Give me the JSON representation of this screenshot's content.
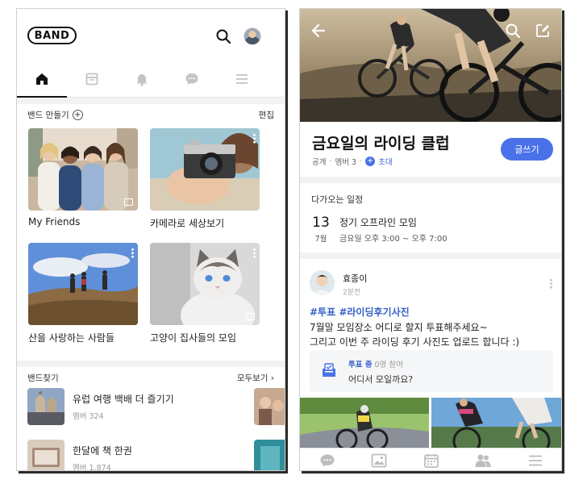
{
  "left": {
    "logo": "BAND",
    "tabs": [
      {
        "id": "home",
        "icon": "home-icon",
        "active": true
      },
      {
        "id": "page",
        "icon": "page-icon",
        "active": false
      },
      {
        "id": "notifications",
        "icon": "bell-icon",
        "active": false
      },
      {
        "id": "chat",
        "icon": "chat-icon",
        "active": false
      },
      {
        "id": "menu",
        "icon": "menu-icon",
        "active": false
      }
    ],
    "my_bands_header": {
      "create_label": "밴드 만들기",
      "edit_label": "편집"
    },
    "bands": [
      {
        "name": "My Friends"
      },
      {
        "name": "카메라로 세상보기"
      },
      {
        "name": "산을 사랑하는 사람들"
      },
      {
        "name": "고양이 집사들의 모임"
      }
    ],
    "find_header": {
      "title": "밴드찾기",
      "see_all": "모두보기 ›"
    },
    "find_list": [
      {
        "title": "유럽 여행 백배 더 즐기기",
        "meta": "멤버 324"
      },
      {
        "title": "한달에 책 한권",
        "meta": "멤버 1,874"
      }
    ]
  },
  "right": {
    "band": {
      "title": "금요일의 라이딩 클럽",
      "visibility": "공개",
      "members": "멤버 3",
      "invite_label": "초대",
      "write_label": "글쓰기"
    },
    "upcoming": {
      "header": "다가오는 일정",
      "day": "13",
      "month": "7월",
      "title": "정기 오프라인 모임",
      "time": "금요일 오후 3:00 ~ 오후 7:00"
    },
    "post": {
      "author": "효종이",
      "time": "2분전",
      "tags": "#투표 #라이딩후기사진",
      "lines": [
        "7월말 모임장소 어디로 할지 투표해주세요~",
        "그리고 이번 주 라이딩 후기 사진도 업로드 합니다 :)"
      ],
      "poll": {
        "status": "투표 중",
        "count": "0명 참여",
        "question": "어디서 모일까요?"
      }
    },
    "bottom_nav": [
      "chat-icon",
      "photo-icon",
      "calendar-icon",
      "members-icon",
      "menu-icon"
    ]
  },
  "colors": {
    "accent": "#4a72e8",
    "link": "#3561c9",
    "divider": "#f2f2f2"
  }
}
